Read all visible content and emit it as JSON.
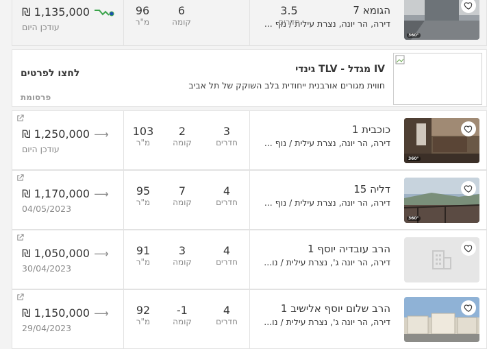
{
  "colors": {
    "accent": "#3aa34a",
    "trend_dot": "#1a4fb0",
    "text": "#363636",
    "muted": "#8a8a8a"
  },
  "listings_top": {
    "street": "הגומא 7",
    "sub": "דירה, הר יונה, נצרת עילית / נוף ...",
    "rooms": "3.5",
    "rooms_label": "חדרים",
    "floor": "6",
    "floor_label": "קומה",
    "sqm": "96",
    "sqm_label": "מ\"ר",
    "price": "₪ 1,135,000",
    "date": "עודכן היום",
    "trend_icon": "trend-down-icon"
  },
  "ad": {
    "title": "גינדי TLV - מגדל IV",
    "desc": "חווית מגורים אורבנית ייחודית בלב השוקק של תל אביב",
    "cta": "לחצו לפרטים",
    "sponsor": "פרסומת"
  },
  "listings": [
    {
      "street": "כוכבית 1",
      "sub": "דירה, הר יונה, נצרת עילית / נוף ...",
      "rooms": "3",
      "floor": "2",
      "sqm": "103",
      "price": "₪ 1,250,000",
      "date": "עודכן היום",
      "image": "kitchen"
    },
    {
      "street": "דליה 15",
      "sub": "דירה, הר יונה, נצרת עילית / נוף ...",
      "rooms": "4",
      "floor": "7",
      "sqm": "95",
      "price": "₪ 1,170,000",
      "date": "04/05/2023",
      "image": "balcony"
    },
    {
      "street": "הרב עובדיה יוסף 1",
      "sub": "דירה, הר יונה ג', נצרת עילית / נו...",
      "rooms": "4",
      "floor": "3",
      "sqm": "91",
      "price": "₪ 1,050,000",
      "date": "30/04/2023",
      "image": "placeholder"
    },
    {
      "street": "הרב שלום יוסף אלישיב 1",
      "sub": "דירה, הר יונה ג', נצרת עילית / נו...",
      "rooms": "4",
      "floor": "-1",
      "sqm": "92",
      "price": "₪ 1,150,000",
      "date": "29/04/2023",
      "image": "buildings"
    }
  ],
  "labels": {
    "rooms": "חדרים",
    "floor": "קומה",
    "sqm": "מ\"ר"
  }
}
